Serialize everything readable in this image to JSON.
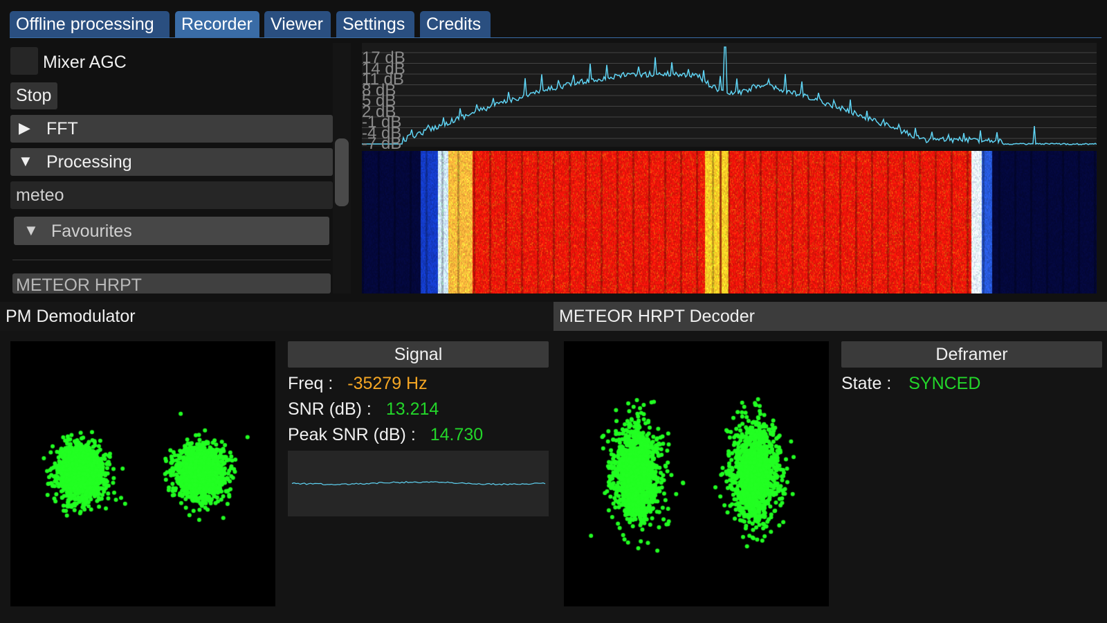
{
  "tabs": [
    "Offline processing",
    "Recorder",
    "Viewer",
    "Settings",
    "Credits"
  ],
  "left_panel": {
    "mixer_agc_label": "Mixer AGC",
    "stop_label": "Stop",
    "fft_label": "FFT",
    "processing_label": "Processing",
    "category_value": "meteo",
    "favourites_label": "Favourites",
    "pipeline_item": "METEOR HRPT"
  },
  "spectrum": {
    "db_labels": [
      "17 dB",
      "14 dB",
      "11 dB",
      "8 dB",
      "5 dB",
      "2 dB",
      "-1 dB",
      "-4 dB",
      "-7 dB"
    ],
    "trace_color": "#5fd3f3"
  },
  "pm_demod": {
    "title": "PM Demodulator",
    "signal_header": "Signal",
    "freq_label": "Freq :",
    "freq_value": "-35279 Hz",
    "snr_label": "SNR (dB) :",
    "snr_value": "13.214",
    "peak_label": "Peak SNR (dB) :",
    "peak_value": "14.730"
  },
  "decoder": {
    "title": "METEOR HRPT Decoder",
    "deframer_header": "Deframer",
    "state_label": "State :",
    "state_value": "SYNCED"
  },
  "colors": {
    "tab_active": "#3a6ca6",
    "constellation_points": "#22ff22",
    "freq_value": "#f5a623",
    "good_value": "#23d62a"
  }
}
